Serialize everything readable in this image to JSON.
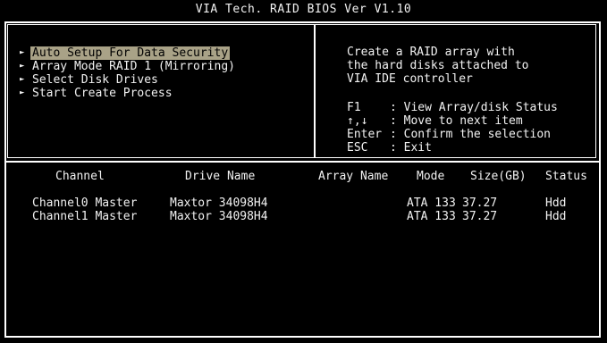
{
  "title": "VIA Tech. RAID BIOS Ver V1.10",
  "menu": [
    {
      "label": "Auto Setup For Data Security",
      "selected": true
    },
    {
      "label": "Array Mode RAID 1 (Mirroring)",
      "selected": false
    },
    {
      "label": "Select Disk Drives",
      "selected": false
    },
    {
      "label": "Start Create Process",
      "selected": false
    }
  ],
  "help": {
    "lines": [
      "Create a RAID array with",
      "the hard disks attached to",
      "VIA IDE controller"
    ],
    "keys": [
      {
        "key": "F1",
        "desc": ": View Array/disk Status"
      },
      {
        "key": "↑,↓",
        "desc": ": Move to next item"
      },
      {
        "key": "Enter",
        "desc": ": Confirm the selection"
      },
      {
        "key": "ESC",
        "desc": ": Exit"
      }
    ]
  },
  "table": {
    "columns": [
      "Channel",
      "Drive Name",
      "Array Name",
      "Mode",
      "Size(GB)",
      "Status"
    ],
    "rows": [
      {
        "channel": "Channel0 Master",
        "drive": "Maxtor 34098H4",
        "array": "",
        "mode": "ATA 133",
        "size": "37.27",
        "status": "Hdd"
      },
      {
        "channel": "Channel1 Master",
        "drive": "Maxtor 34098H4",
        "array": "",
        "mode": "ATA 133",
        "size": "37.27",
        "status": "Hdd"
      }
    ]
  }
}
